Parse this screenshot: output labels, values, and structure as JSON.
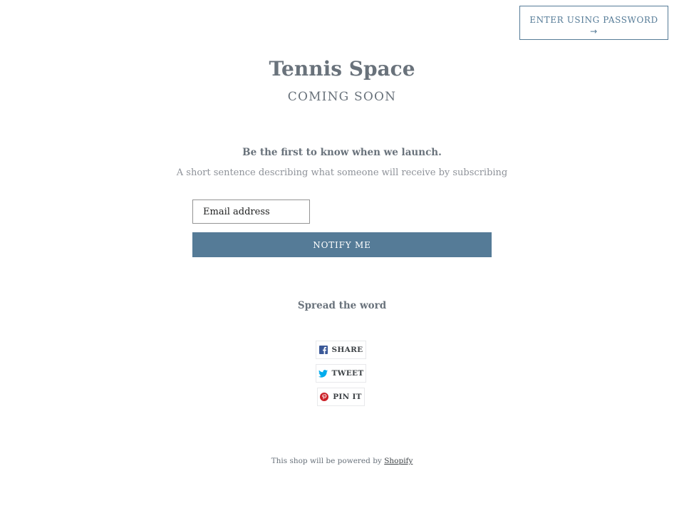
{
  "header": {
    "password_button_label": "Enter using password",
    "password_button_arrow": "→"
  },
  "hero": {
    "title": "Tennis Space",
    "subtitle": "Coming Soon"
  },
  "newsletter": {
    "heading": "Be the first to know when we launch.",
    "description": "A short sentence describing what someone will receive by subscribing",
    "email_placeholder": "Email address",
    "submit_label": "Notify me"
  },
  "social": {
    "heading": "Spread the word",
    "buttons": [
      {
        "label": "Share",
        "icon": "facebook-icon",
        "color": "#3b5998"
      },
      {
        "label": "Tweet",
        "icon": "twitter-icon",
        "color": "#00aced"
      },
      {
        "label": "Pin it",
        "icon": "pinterest-icon",
        "color": "#cb2027"
      }
    ]
  },
  "footer": {
    "text": "This shop will be powered by",
    "link_label": "Shopify"
  },
  "colors": {
    "accent": "#557b97",
    "text": "#69727b"
  }
}
